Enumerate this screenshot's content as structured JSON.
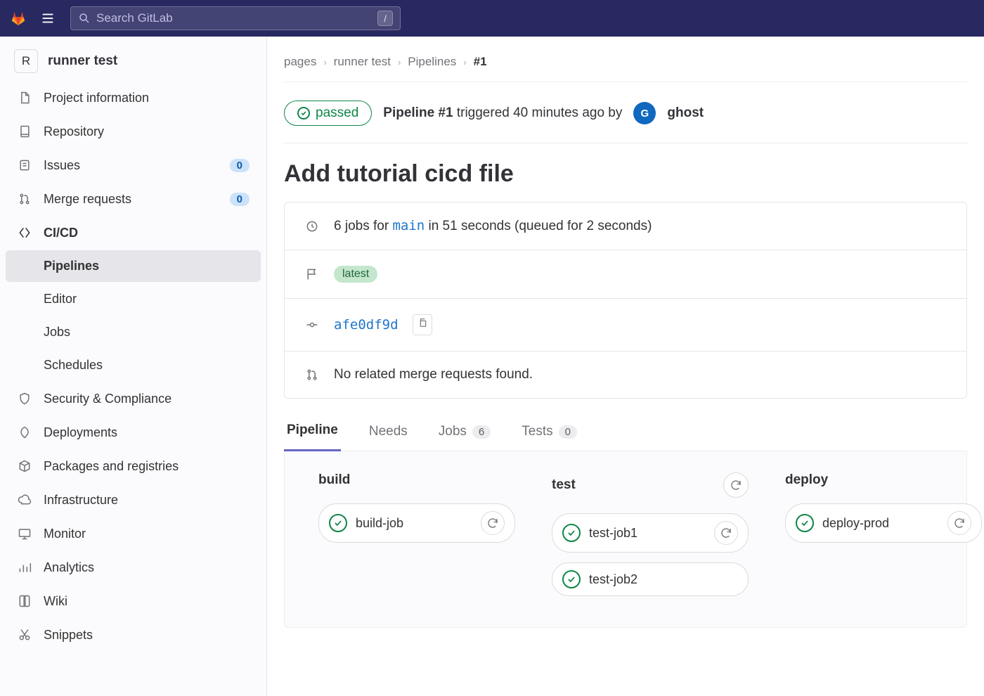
{
  "topbar": {
    "search_placeholder": "Search GitLab",
    "kbd_hint": "/"
  },
  "sidebar": {
    "project_avatar_letter": "R",
    "project_name": "runner test",
    "items": {
      "project_info": "Project information",
      "repository": "Repository",
      "issues": "Issues",
      "issues_count": "0",
      "merge_requests": "Merge requests",
      "merge_requests_count": "0",
      "cicd": "CI/CD",
      "pipelines": "Pipelines",
      "editor": "Editor",
      "jobs": "Jobs",
      "schedules": "Schedules",
      "security": "Security & Compliance",
      "deployments": "Deployments",
      "packages": "Packages and registries",
      "infrastructure": "Infrastructure",
      "monitor": "Monitor",
      "analytics": "Analytics",
      "wiki": "Wiki",
      "snippets": "Snippets"
    }
  },
  "crumbs": {
    "c0": "pages",
    "c1": "runner test",
    "c2": "Pipelines",
    "c3": "#1"
  },
  "pipeline": {
    "status_label": "passed",
    "title_bold": "Pipeline #1",
    "triggered_text": " triggered 40 minutes ago by",
    "user_name": "ghost",
    "user_initial": "G",
    "commit_title": "Add tutorial cicd file",
    "jobs_line_prefix": "6 jobs for ",
    "branch": "main",
    "jobs_line_suffix": " in 51 seconds (queued for 2 seconds)",
    "latest_badge": "latest",
    "commit_sha": "afe0df9d",
    "mr_text": "No related merge requests found."
  },
  "tabs": {
    "pipeline": "Pipeline",
    "needs": "Needs",
    "jobs": "Jobs",
    "jobs_count": "6",
    "tests": "Tests",
    "tests_count": "0"
  },
  "stages": {
    "build": {
      "name": "build",
      "jobs": [
        "build-job"
      ]
    },
    "test": {
      "name": "test",
      "jobs": [
        "test-job1",
        "test-job2"
      ]
    },
    "deploy": {
      "name": "deploy",
      "jobs": [
        "deploy-prod"
      ]
    }
  }
}
